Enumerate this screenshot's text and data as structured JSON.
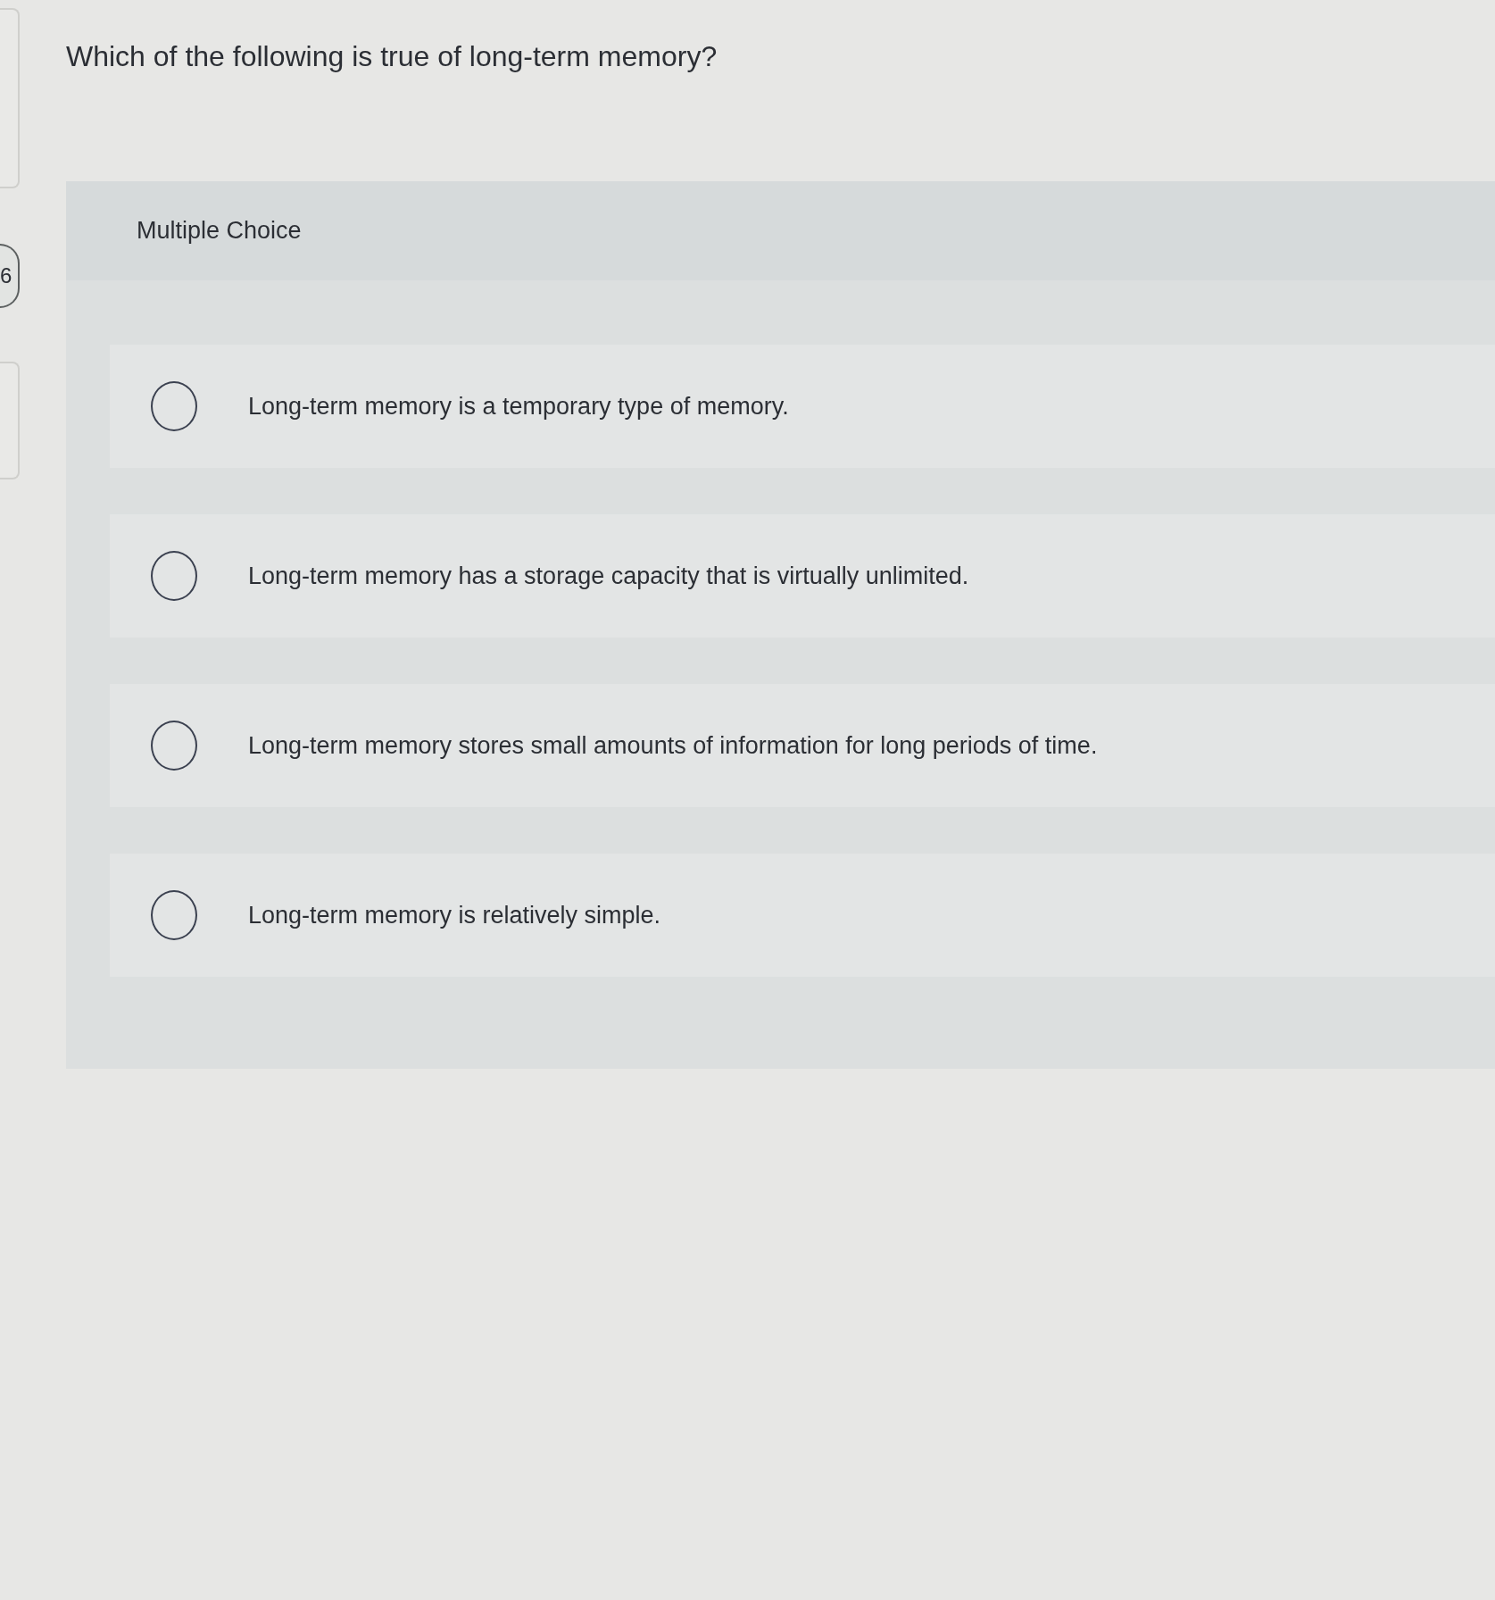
{
  "sidebar": {
    "question_number": "6"
  },
  "question": {
    "prompt": "Which of the following is true of long-term memory?",
    "type_label": "Multiple Choice",
    "options": [
      {
        "text": "Long-term memory is a temporary type of memory.",
        "selected": false
      },
      {
        "text": "Long-term memory has a storage capacity that is virtually unlimited.",
        "selected": false
      },
      {
        "text": "Long-term memory stores small amounts of information for long periods of time.",
        "selected": false
      },
      {
        "text": "Long-term memory is relatively simple.",
        "selected": false
      }
    ]
  }
}
